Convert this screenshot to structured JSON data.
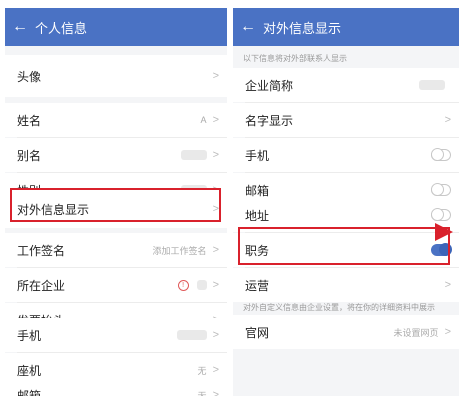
{
  "left": {
    "title": "个人信息",
    "back_icon": "arrow-left-icon",
    "rows": [
      {
        "label": "头像",
        "value": ""
      },
      {
        "label": "姓名",
        "value": "A"
      },
      {
        "label": "别名",
        "value": ""
      },
      {
        "label": "性别",
        "value": ""
      },
      {
        "label": "对外信息显示",
        "value": ""
      },
      {
        "label": "工作签名",
        "value": "添加工作签名"
      },
      {
        "label": "所在企业",
        "value": ""
      },
      {
        "label": "发票抬头",
        "value": ""
      },
      {
        "label": "手机",
        "value": ""
      },
      {
        "label": "座机",
        "value": "无"
      },
      {
        "label": "邮箱",
        "value": "无"
      }
    ]
  },
  "right": {
    "title": "对外信息显示",
    "back_icon": "arrow-left-icon",
    "hint_top": "以下信息将对外部联系人显示",
    "rows": [
      {
        "label": "企业简称"
      },
      {
        "label": "名字显示"
      },
      {
        "label": "手机",
        "toggle": false
      },
      {
        "label": "邮箱",
        "toggle": false
      },
      {
        "label": "地址",
        "toggle": false
      },
      {
        "label": "职务",
        "toggle": true
      },
      {
        "label": "运营"
      }
    ],
    "hint_bottom": "对外自定义信息由企业设置，将在你的详细资料中展示",
    "website": {
      "label": "官网",
      "value": "未设置网页"
    }
  },
  "colors": {
    "header": "#4a72c4",
    "highlight": "#d9212c"
  }
}
